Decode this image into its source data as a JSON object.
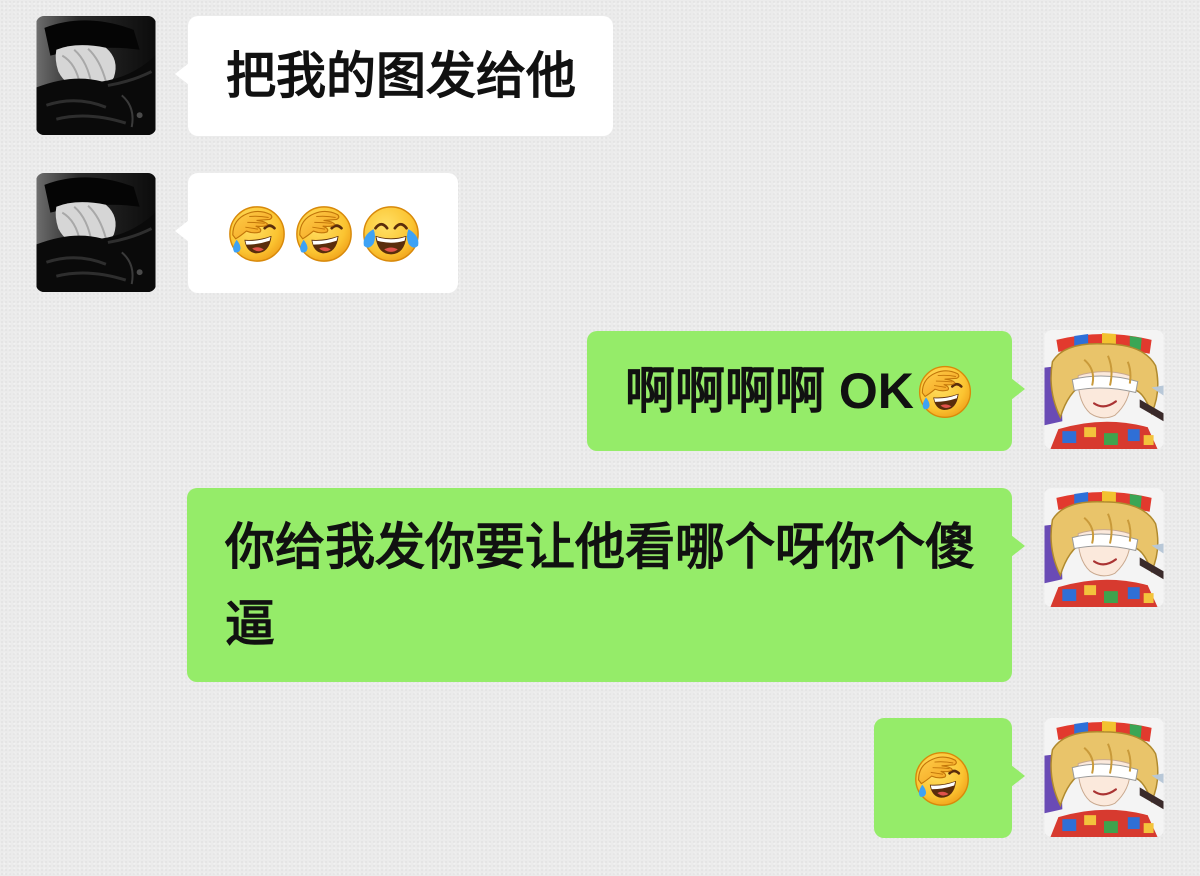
{
  "theme": {
    "background": "#ebebeb",
    "incoming_bubble": "#ffffff",
    "outgoing_bubble": "#95ec69",
    "text": "#111111"
  },
  "messages": [
    {
      "avatar_icon": "contact-avatar",
      "bubble_color": "#ffffff",
      "text": "把我的图发给他"
    },
    {
      "avatar_icon": "contact-avatar",
      "bubble_color": "#ffffff",
      "emoji_icons": [
        "facepalm-emoji-icon",
        "facepalm-emoji-icon",
        "tears-of-joy-emoji-icon"
      ]
    },
    {
      "avatar_icon": "self-avatar",
      "bubble_color": "#95ec69",
      "text": "啊啊啊啊 OK",
      "emoji_icons": [
        "facepalm-emoji-icon"
      ]
    },
    {
      "avatar_icon": "self-avatar",
      "bubble_color": "#95ec69",
      "text": "你给我发你要让他看哪个呀你个傻逼"
    },
    {
      "avatar_icon": "self-avatar",
      "bubble_color": "#95ec69",
      "emoji_icons": [
        "facepalm-emoji-icon"
      ]
    }
  ]
}
